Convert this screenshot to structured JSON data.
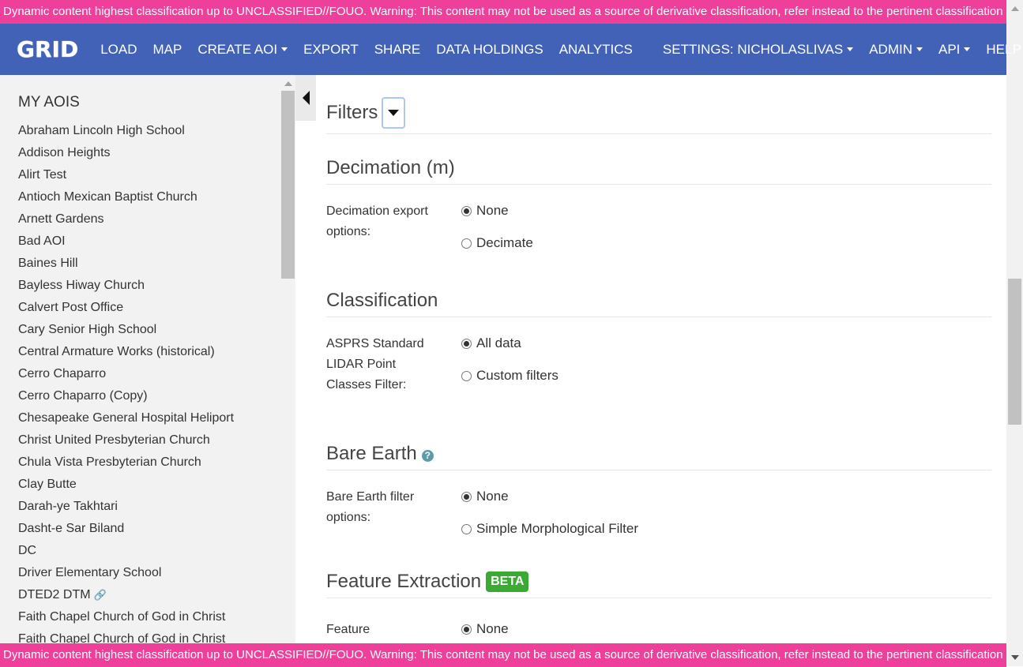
{
  "banner": {
    "text": "Dynamic content highest classification up to UNCLASSIFIED//FOUO. Warning: This content may not be used as a source of derivative classification, refer instead to the pertinent classification guide."
  },
  "navbar": {
    "logo": "GRID",
    "items": [
      {
        "label": "LOAD"
      },
      {
        "label": "MAP"
      },
      {
        "label": "CREATE AOI"
      },
      {
        "label": "EXPORT"
      },
      {
        "label": "SHARE"
      },
      {
        "label": "DATA HOLDINGS"
      },
      {
        "label": "ANALYTICS"
      },
      {
        "label": "SETTINGS: NICHOLASLIVAS"
      },
      {
        "label": "ADMIN"
      },
      {
        "label": "API"
      },
      {
        "label": "HELP"
      }
    ]
  },
  "sidebar": {
    "title": "MY AOIS",
    "items": [
      {
        "label": "Abraham Lincoln High School"
      },
      {
        "label": "Addison Heights"
      },
      {
        "label": "Alirt Test"
      },
      {
        "label": "Antioch Mexican Baptist Church"
      },
      {
        "label": "Arnett Gardens"
      },
      {
        "label": "Bad AOI"
      },
      {
        "label": "Baines Hill"
      },
      {
        "label": "Bayless Hiway Church"
      },
      {
        "label": "Calvert Post Office"
      },
      {
        "label": "Cary Senior High School"
      },
      {
        "label": "Central Armature Works (historical)"
      },
      {
        "label": "Cerro Chaparro"
      },
      {
        "label": "Cerro Chaparro (Copy)"
      },
      {
        "label": "Chesapeake General Hospital Heliport"
      },
      {
        "label": "Christ United Presbyterian Church"
      },
      {
        "label": "Chula Vista Presbyterian Church"
      },
      {
        "label": "Clay Butte"
      },
      {
        "label": "Darah-ye Takhtari"
      },
      {
        "label": "Dasht-e Sar Biland"
      },
      {
        "label": "DC"
      },
      {
        "label": "Driver Elementary School"
      },
      {
        "label": "DTED2 DTM"
      },
      {
        "label": "Faith Chapel Church of God in Christ"
      },
      {
        "label": "Faith Chapel Church of God in Christ"
      }
    ]
  },
  "main": {
    "filters": {
      "title": "Filters"
    },
    "decimation": {
      "title": "Decimation (m)",
      "label": "Decimation export options:",
      "options": [
        {
          "label": "None",
          "checked": true
        },
        {
          "label": "Decimate",
          "checked": false
        }
      ]
    },
    "classification": {
      "title": "Classification",
      "label": "ASPRS Standard LIDAR Point Classes Filter:",
      "options": [
        {
          "label": "All data",
          "checked": true
        },
        {
          "label": "Custom filters",
          "checked": false
        }
      ]
    },
    "bare_earth": {
      "title": "Bare Earth",
      "label": "Bare Earth filter options:",
      "options": [
        {
          "label": "None",
          "checked": true
        },
        {
          "label": "Simple Morphological Filter",
          "checked": false
        }
      ]
    },
    "feature_extraction": {
      "title": "Feature Extraction",
      "badge": "BETA",
      "label": "Feature",
      "options": [
        {
          "label": "None",
          "checked": true
        }
      ]
    }
  }
}
